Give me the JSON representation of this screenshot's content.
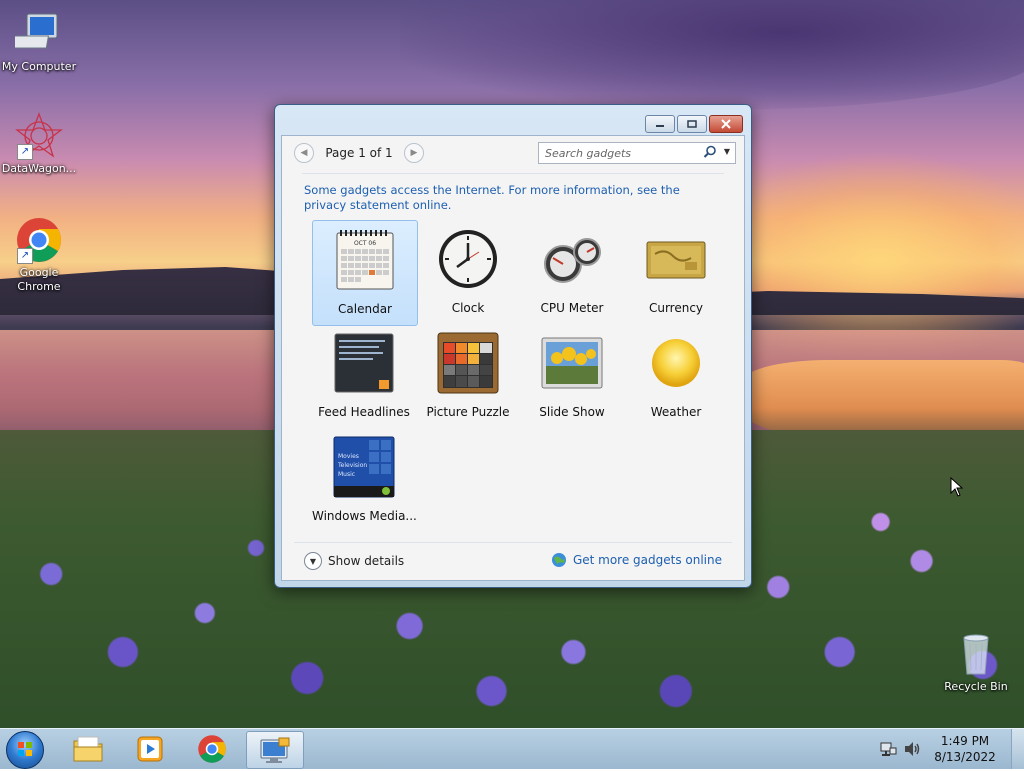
{
  "desktop": {
    "icons": [
      {
        "label": "My Computer",
        "icon": "computer-icon"
      },
      {
        "label": "DataWagon...",
        "icon": "datawagon-icon"
      },
      {
        "label": "Google Chrome",
        "icon": "chrome-icon"
      },
      {
        "label": "Recycle Bin",
        "icon": "recycle-bin-icon"
      }
    ]
  },
  "window": {
    "pager": {
      "text": "Page 1 of 1"
    },
    "search": {
      "placeholder": "Search gadgets"
    },
    "notice": "Some gadgets access the Internet.  For more information, see the privacy statement online.",
    "gadgets": [
      {
        "label": "Calendar",
        "icon": "calendar-icon",
        "selected": true
      },
      {
        "label": "Clock",
        "icon": "clock-icon"
      },
      {
        "label": "CPU Meter",
        "icon": "cpu-meter-icon"
      },
      {
        "label": "Currency",
        "icon": "currency-icon"
      },
      {
        "label": "Feed Headlines",
        "icon": "feed-headlines-icon"
      },
      {
        "label": "Picture Puzzle",
        "icon": "picture-puzzle-icon"
      },
      {
        "label": "Slide Show",
        "icon": "slide-show-icon"
      },
      {
        "label": "Weather",
        "icon": "weather-icon"
      },
      {
        "label": "Windows Media...",
        "icon": "windows-media-icon"
      }
    ],
    "calendar_month": "OCT 06",
    "media_menu": [
      "Movies",
      "Television",
      "Music"
    ],
    "show_details": "Show details",
    "more_online": "Get more gadgets online"
  },
  "taskbar": {
    "items": [
      "start-orb-icon",
      "file-explorer-icon",
      "media-player-icon",
      "chrome-icon",
      "gadgets-icon"
    ],
    "active_index": 4,
    "time": "1:49 PM",
    "date": "8/13/2022"
  },
  "colors": {
    "link": "#1d5fb0",
    "selection": "#c4e0fb",
    "window_frame": "#c2d6ea"
  }
}
